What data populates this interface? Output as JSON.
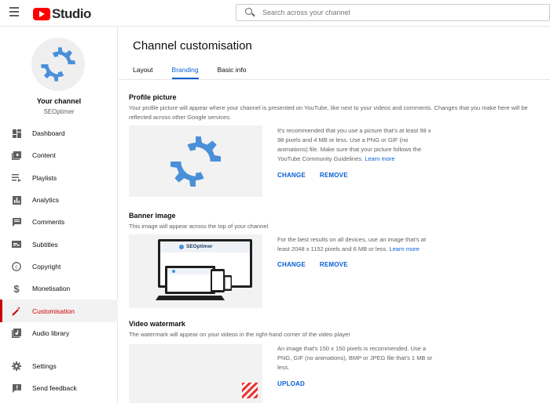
{
  "header": {
    "logo_text": "Studio",
    "search_placeholder": "Search across your channel"
  },
  "sidebar": {
    "channel_title": "Your channel",
    "channel_name": "SEOptimer",
    "items": [
      {
        "label": "Dashboard",
        "icon": "dashboard-icon"
      },
      {
        "label": "Content",
        "icon": "content-icon"
      },
      {
        "label": "Playlists",
        "icon": "playlists-icon"
      },
      {
        "label": "Analytics",
        "icon": "analytics-icon"
      },
      {
        "label": "Comments",
        "icon": "comments-icon"
      },
      {
        "label": "Subtitles",
        "icon": "subtitles-icon"
      },
      {
        "label": "Copyright",
        "icon": "copyright-icon"
      },
      {
        "label": "Monetisation",
        "icon": "monetisation-icon"
      },
      {
        "label": "Customisation",
        "icon": "customisation-icon",
        "active": true
      },
      {
        "label": "Audio library",
        "icon": "audio-library-icon"
      }
    ],
    "bottom_items": [
      {
        "label": "Settings",
        "icon": "gear-icon"
      },
      {
        "label": "Send feedback",
        "icon": "feedback-icon"
      }
    ]
  },
  "main": {
    "title": "Channel customisation",
    "tabs": [
      {
        "label": "Layout"
      },
      {
        "label": "Branding",
        "active": true
      },
      {
        "label": "Basic info"
      }
    ],
    "profile": {
      "title": "Profile picture",
      "description": "Your profile picture will appear where your channel is presented on YouTube, like next to your videos and comments. Changes that you make here will be reflected across other Google services.",
      "info": "It's recommended that you use a picture that's at least 98 x 98 pixels and 4 MB or less. Use a PNG or GIF (no animations) file. Make sure that your picture follows the YouTube Community Guidelines.",
      "learn_more": "Learn more",
      "change": "CHANGE",
      "remove": "REMOVE"
    },
    "banner": {
      "title": "Banner image",
      "description": "This image will appear across the top of your channel",
      "info": "For the best results on all devices, use an image that's at least 2048 x 1152 pixels and 6 MB or less.",
      "learn_more": "Learn more",
      "change": "CHANGE",
      "remove": "REMOVE",
      "preview_brand": "SEOptimer"
    },
    "watermark": {
      "title": "Video watermark",
      "description": "The watermark will appear on your videos in the right-hand corner of the video player",
      "info": "An image that's 150 x 150 pixels is recommended. Use a PNG, GIF (no animations), BMP or JPEG file that's 1 MB or less.",
      "upload": "UPLOAD"
    }
  },
  "colors": {
    "accent_blue": "#065fd4",
    "active_red": "#cc0000",
    "logo_red": "#ff0000",
    "gear_blue": "#4a90d9"
  }
}
